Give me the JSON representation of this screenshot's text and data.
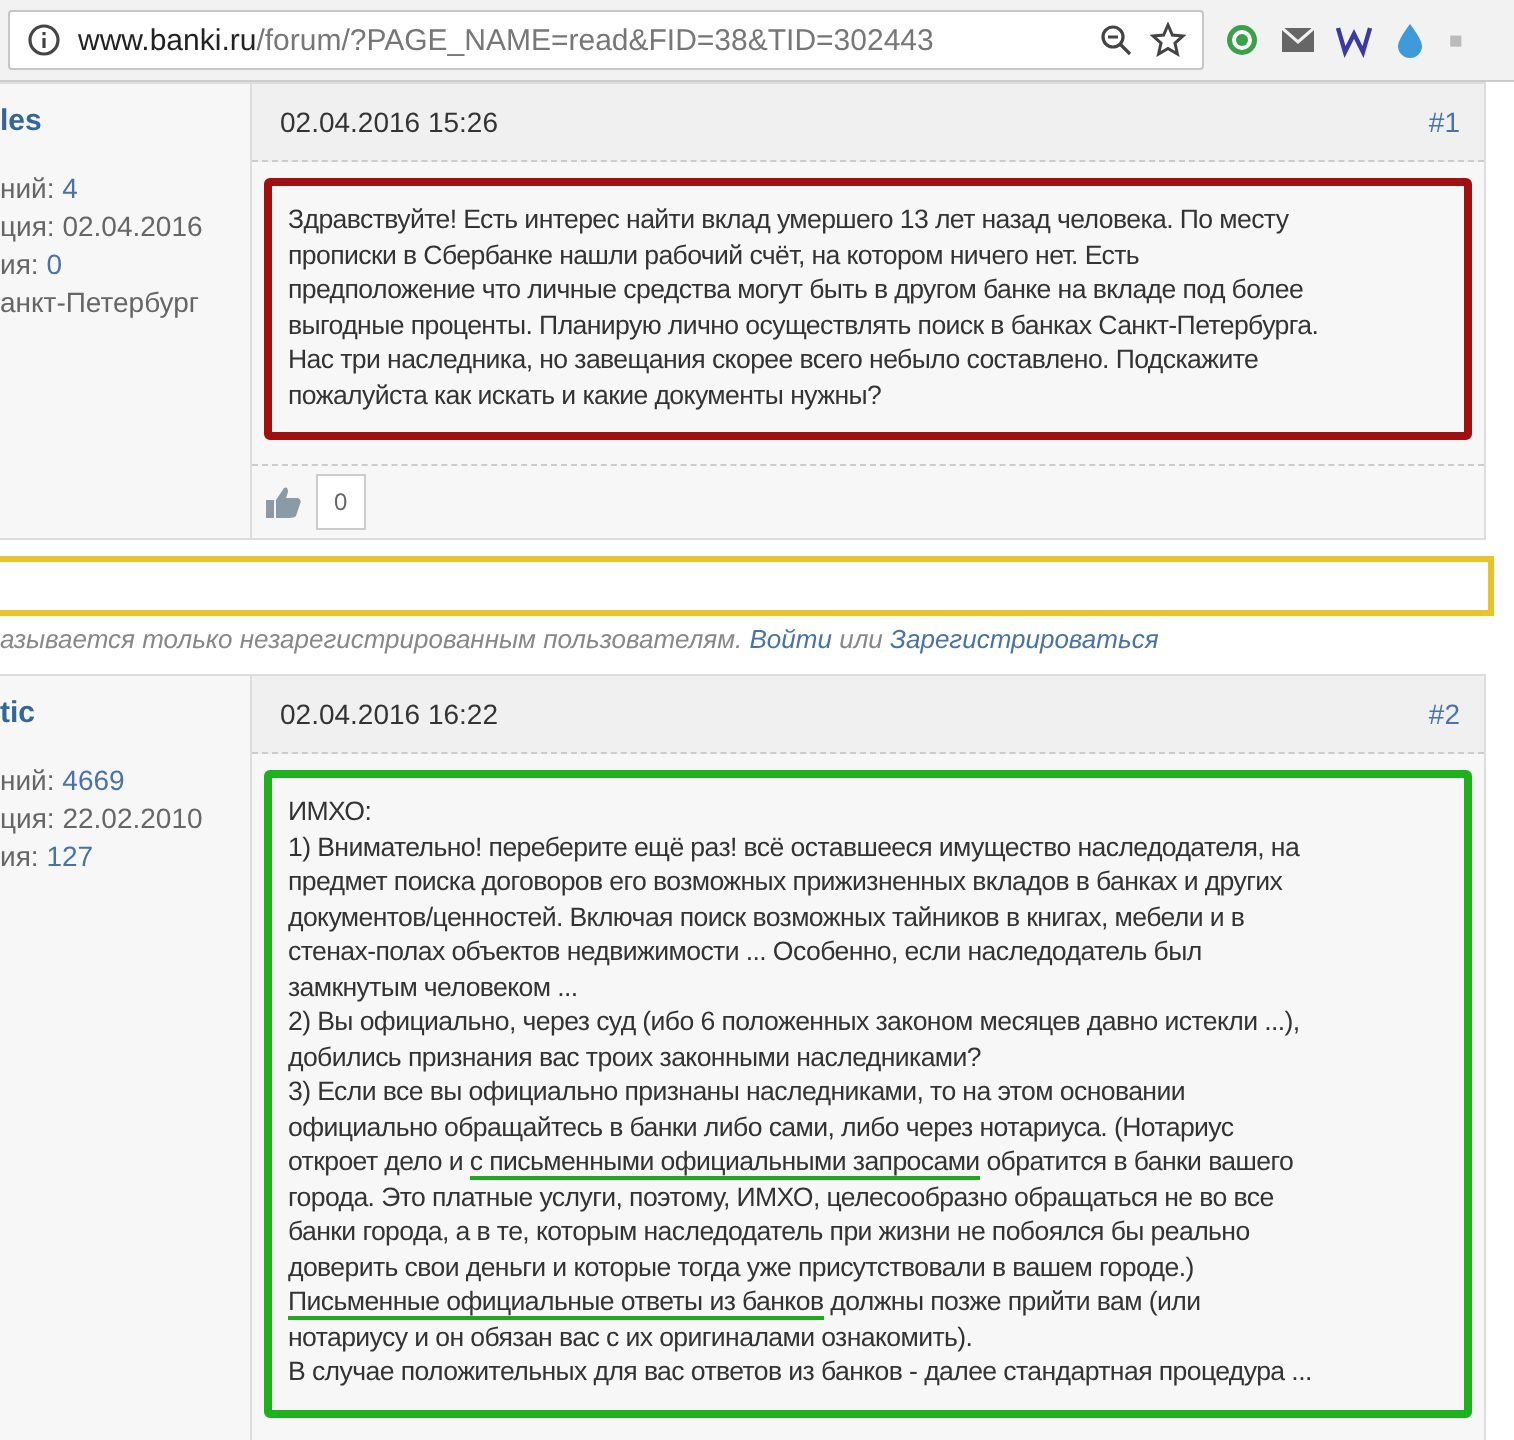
{
  "browser": {
    "url_host": "www.banki.ru",
    "url_path": "/forum/?PAGE_NAME=read&FID=38&TID=302443"
  },
  "posts": [
    {
      "author": "les",
      "stats": [
        {
          "label": "ний:",
          "value": "4",
          "link": true
        },
        {
          "label": "ция:",
          "value": "02.04.2016",
          "link": false
        },
        {
          "label": "ия:",
          "value": "0",
          "link": true
        },
        {
          "value": "анкт-Петербург",
          "link": false
        }
      ],
      "date": "02.04.2016 15:26",
      "number": "#1",
      "color": "#a01010",
      "segments": [
        {
          "text": "Здравствуйте! Есть интерес найти вклад умершего 13 лет назад человека. По месту\nпрописки в Сбербанке нашли рабочий счёт, на котором ничего нет. Есть\nпредположение что личные средства могут быть в другом банке на вкладе под более\nвыгодные проценты. Планирую лично осуществлять поиск в банках Санкт-Петербурга.\nНас три наследника, но завещания скорее всего небыло составлено. Подскажите\nпожалуйста как искать и какие документы нужны?",
          "underlined": false
        }
      ],
      "likes": "0"
    },
    {
      "author": "tic",
      "stats": [
        {
          "label": "ний:",
          "value": "4669",
          "link": true
        },
        {
          "label": "ция:",
          "value": "22.02.2010",
          "link": false
        },
        {
          "label": "ия:",
          "value": "127",
          "link": true
        }
      ],
      "date": "02.04.2016 16:22",
      "number": "#2",
      "color": "#1db21d",
      "segments": [
        {
          "text": "ИМХО:\n1) Внимательно! переберите ещё раз! всё оставшееся имущество наследодателя, на\nпредмет поиска договоров его возможных прижизненных вкладов в банках и других\nдокументов/ценностей. Включая поиск возможных тайников в книгах, мебели и в\nстенах-полах объектов недвижимости ... Особенно, если наследодатель был\nзамкнутым человеком ...\n2) Вы официально, через суд (ибо 6 положенных законом месяцев давно истекли ...),\nдобились признания вас троих законными наследниками?\n3) Если все вы официально признаны наследниками, то на этом основании\nофициально обращайтесь в банки либо сами, либо через нотариуса. (Нотариус\nоткроет дело и ",
          "underlined": false
        },
        {
          "text": "с письменными официальными запросами",
          "underlined": true
        },
        {
          "text": " обратится в банки вашего\nгорода. Это платные услуги, поэтому, ИМХО, целесообразно обращаться не во все\nбанки города, а в те, которым наследодатель при жизни не побоялся бы реально\nдоверить свои деньги и которые тогда уже присутствовали в вашем городе.)\n",
          "underlined": false
        },
        {
          "text": "Письменные официальные ответы из банков",
          "underlined": true
        },
        {
          "text": " должны позже прийти вам (или\nнотариусу и он обязан вас с их оригиналами ознакомить).\nВ случае положительных для вас ответов из банков - далее стандартная процедура ...",
          "underlined": false
        }
      ]
    }
  ],
  "notice": {
    "text": "азывается только незарегистрированным пользователям.",
    "login": "Войти",
    "or": "или",
    "register": "Зарегистрироваться"
  }
}
